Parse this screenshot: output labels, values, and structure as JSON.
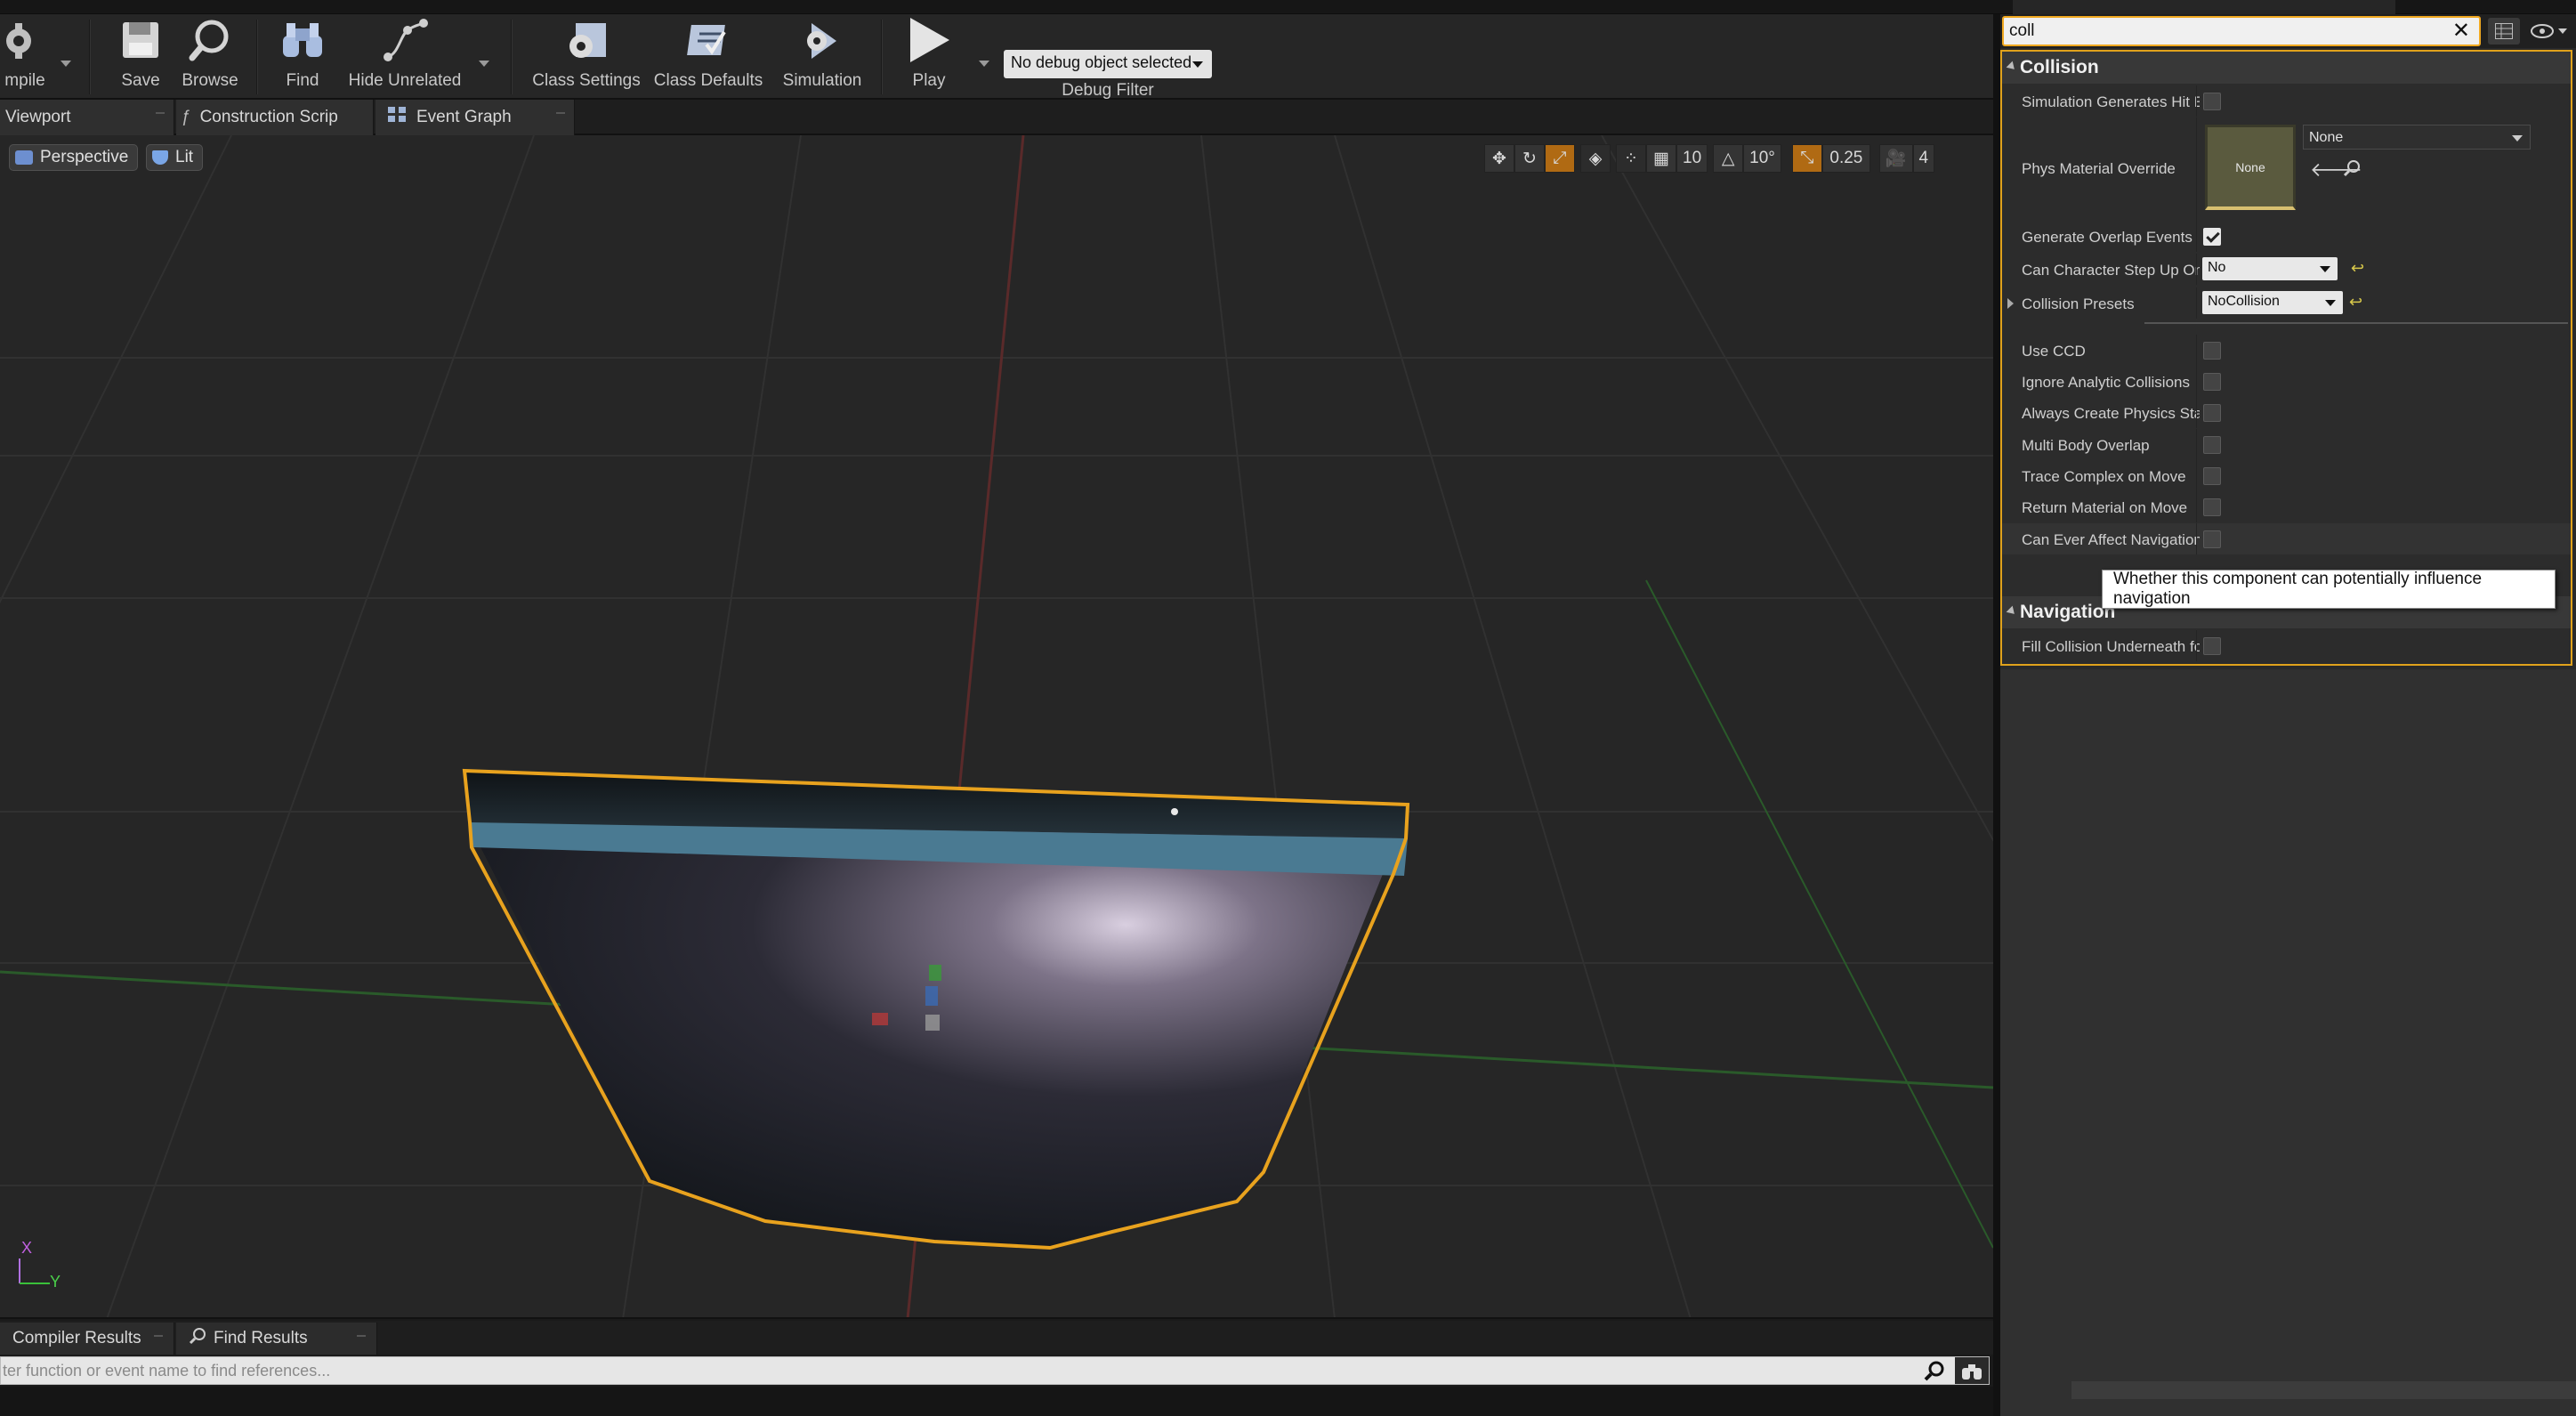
{
  "toolbar": {
    "compile_label": "mpile",
    "save_label": "Save",
    "browse_label": "Browse",
    "find_label": "Find",
    "hide_unrelated_label": "Hide Unrelated",
    "class_settings_label": "Class Settings",
    "class_defaults_label": "Class Defaults",
    "simulation_label": "Simulation",
    "play_label": "Play",
    "debug_object_value": "No debug object selected",
    "debug_filter_label": "Debug Filter"
  },
  "tabs": {
    "viewport": "Viewport",
    "construction_script": "Construction Script",
    "event_graph": "Event Graph"
  },
  "viewport": {
    "perspective_label": "Perspective",
    "lit_label": "Lit",
    "grid_snap_value": "10",
    "rotation_snap_value": "10°",
    "scale_snap_value": "0.25",
    "camera_speed_value": "4",
    "axis_x_label": "X",
    "axis_y_label": "Y",
    "colors": {
      "selection_outline": "#e8a21e",
      "grid_x": "#5a2a2a",
      "grid_y": "#2a5a2a"
    }
  },
  "bottom": {
    "compiler_results_tab": "Compiler Results",
    "find_results_tab": "Find Results",
    "find_placeholder": "ter function or event name to find references..."
  },
  "details": {
    "search_value": "coll",
    "collision": {
      "header": "Collision",
      "sim_hit_events_label": "Simulation Generates Hit Events",
      "phys_material_label": "Phys Material Override",
      "phys_material_thumb": "None",
      "phys_material_value": "None",
      "overlap_events_label": "Generate Overlap Events",
      "step_up_label": "Can Character Step Up On",
      "step_up_value": "No",
      "presets_label": "Collision Presets",
      "presets_value": "NoCollision",
      "use_ccd_label": "Use CCD",
      "ignore_analytic_label": "Ignore Analytic Collisions",
      "always_create_label": "Always Create Physics State",
      "multi_body_label": "Multi Body Overlap",
      "trace_complex_label": "Trace Complex on Move",
      "return_material_label": "Return Material on Move",
      "affect_nav_label": "Can Ever Affect Navigation"
    },
    "tooltip_text": "Whether this component can potentially influence navigation",
    "navigation": {
      "header": "Navigation",
      "fill_collision_label": "Fill Collision Underneath for Navmesh"
    },
    "accent_color": "#e0a21c"
  }
}
